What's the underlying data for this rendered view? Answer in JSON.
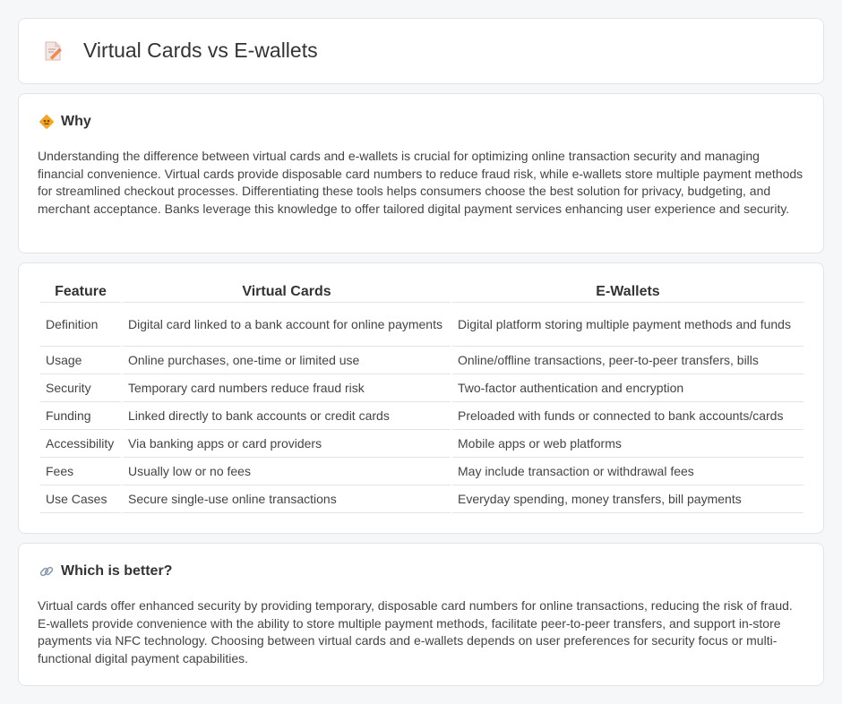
{
  "header": {
    "title": "Virtual Cards vs E-wallets",
    "icon": "pencil-document-icon"
  },
  "why": {
    "title": "Why",
    "icon": "diamond-sign-icon",
    "body": "Understanding the difference between virtual cards and e-wallets is crucial for optimizing online transaction security and managing financial convenience. Virtual cards provide disposable card numbers to reduce fraud risk, while e-wallets store multiple payment methods for streamlined checkout processes. Differentiating these tools helps consumers choose the best solution for privacy, budgeting, and merchant acceptance. Banks leverage this knowledge to offer tailored digital payment services enhancing user experience and security."
  },
  "table": {
    "headers": [
      "Feature",
      "Virtual Cards",
      "E-Wallets"
    ],
    "rows": [
      [
        "Definition",
        "Digital card linked to a bank account for online payments",
        "Digital platform storing multiple payment methods and funds"
      ],
      [
        "Usage",
        "Online purchases, one-time or limited use",
        "Online/offline transactions, peer-to-peer transfers, bills"
      ],
      [
        "Security",
        "Temporary card numbers reduce fraud risk",
        "Two-factor authentication and encryption"
      ],
      [
        "Funding",
        "Linked directly to bank accounts or credit cards",
        "Preloaded with funds or connected to bank accounts/cards"
      ],
      [
        "Accessibility",
        "Via banking apps or card providers",
        "Mobile apps or web platforms"
      ],
      [
        "Fees",
        "Usually low or no fees",
        "May include transaction or withdrawal fees"
      ],
      [
        "Use Cases",
        "Secure single-use online transactions",
        "Everyday spending, money transfers, bill payments"
      ]
    ]
  },
  "better": {
    "title": "Which is better?",
    "icon": "link-icon",
    "body": "Virtual cards offer enhanced security by providing temporary, disposable card numbers for online transactions, reducing the risk of fraud. E-wallets provide convenience with the ability to store multiple payment methods, facilitate peer-to-peer transfers, and support in-store payments via NFC technology. Choosing between virtual cards and e-wallets depends on user preferences for security focus or multi-functional digital payment capabilities."
  }
}
